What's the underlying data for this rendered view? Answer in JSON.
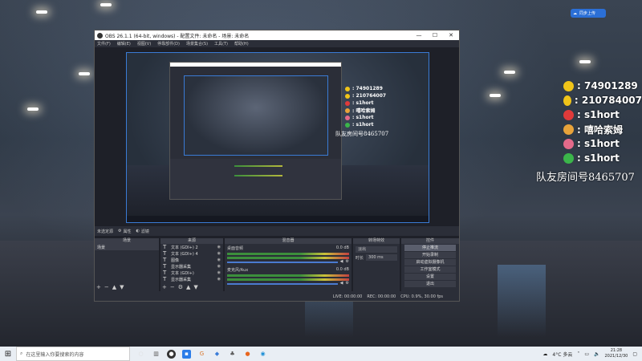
{
  "desktop": {
    "top_right_button": "同步上传",
    "overlay": {
      "rows": [
        {
          "icon": "qq-icon",
          "color": "#f0c419",
          "text": ": 74901289"
        },
        {
          "icon": "qq-icon",
          "color": "#f0c419",
          "text": ": 210784007"
        },
        {
          "icon": "netease-icon",
          "color": "#e03a3a",
          "text": ": s1hort"
        },
        {
          "icon": "weibo-icon",
          "color": "#e8a33a",
          "text": ": 嘻哈索姆"
        },
        {
          "icon": "message-icon",
          "color": "#e46a8a",
          "text": ": s1hort"
        },
        {
          "icon": "wechat-icon",
          "color": "#3bb54a",
          "text": ": s1hort"
        }
      ],
      "room": "队友房间号8465707"
    }
  },
  "obs": {
    "title": "OBS 26.1.1 (64-bit, windows) - 配置文件: 未命名 - 场景: 未命名",
    "menu": [
      "文件(F)",
      "编辑(E)",
      "视图(V)",
      "停靠部件(D)",
      "场景集合(S)",
      "工具(T)",
      "帮助(H)"
    ],
    "window_controls": [
      "—",
      "☐",
      "✕"
    ],
    "preview_overlay": {
      "rows": [
        {
          "color": "#f0c419",
          "text": ": 74901289"
        },
        {
          "color": "#f0c419",
          "text": ": 210764007"
        },
        {
          "color": "#e03a3a",
          "text": ": s1hort"
        },
        {
          "color": "#e8a33a",
          "text": ": 嘻哈索姆"
        },
        {
          "color": "#e46a8a",
          "text": ": s1hort"
        },
        {
          "color": "#3bb54a",
          "text": ": s1hort"
        }
      ],
      "room": "队友房间号8465707"
    },
    "source_bar": {
      "label": "未选定源",
      "props": "属性",
      "filters": "滤镜"
    },
    "docks": {
      "scenes": {
        "header": "场景",
        "items": [
          "场景"
        ]
      },
      "sources": {
        "header": "来源",
        "items": [
          {
            "label": "文本 (GDI+) 2"
          },
          {
            "label": "文本 (GDI+) 4"
          },
          {
            "label": "图像"
          },
          {
            "label": "显示器采集"
          },
          {
            "label": "文本 (GDI+)"
          },
          {
            "label": "显示器采集"
          }
        ]
      },
      "mixer": {
        "header": "混音器",
        "channels": [
          {
            "name": "桌面音频",
            "level": "0.0 dB"
          },
          {
            "name": "麦克风/Aux",
            "level": "0.0 dB"
          }
        ]
      },
      "transitions": {
        "header": "转场特效",
        "type": "淡出",
        "duration_label": "时长",
        "duration": "300 ms"
      },
      "controls": {
        "header": "控件",
        "buttons": [
          "停止推流",
          "开始录制",
          "启动虚拟摄像机",
          "工作室模式",
          "设置",
          "退出"
        ]
      }
    },
    "status": {
      "live": "LIVE: 00:00:00",
      "rec": "REC: 00:00:00",
      "cpu": "CPU: 0.9%, 30.00 fps"
    }
  },
  "taskbar": {
    "search_placeholder": "在这里输入你要搜索的内容",
    "weather": "4°C 多云",
    "time": "21:28",
    "date": "2021/12/30"
  }
}
